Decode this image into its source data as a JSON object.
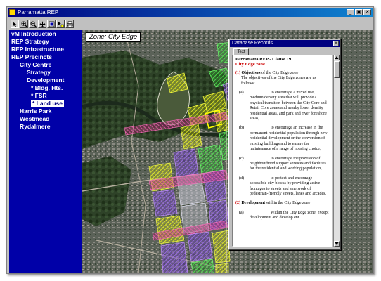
{
  "window": {
    "title": "Parramatta REP",
    "controls": {
      "minimize": "_",
      "maximize": "▣",
      "close": "✕"
    }
  },
  "toolbar": {
    "tools": [
      {
        "icon": "pointer-icon",
        "active": true
      },
      {
        "icon": "zoom-in-icon",
        "active": false
      },
      {
        "icon": "zoom-out-icon",
        "active": false
      },
      {
        "icon": "pan-icon",
        "active": false
      },
      {
        "icon": "full-extent-icon",
        "active": false
      },
      {
        "icon": "identify-icon",
        "active": false
      },
      {
        "icon": "print-icon",
        "active": false
      }
    ]
  },
  "sidebar": {
    "items": [
      {
        "label": "vM Introduction",
        "level": "top"
      },
      {
        "label": "REP Strategy",
        "level": "top"
      },
      {
        "label": "REP Infrastructure",
        "level": "top"
      },
      {
        "label": "REP Precincts",
        "level": "top"
      },
      {
        "label": "City Centre",
        "level": "lvl1"
      },
      {
        "label": "Strategy",
        "level": "lvl2"
      },
      {
        "label": "Development",
        "level": "lvl2"
      },
      {
        "label": "* Bldg. Hts.",
        "level": "lvl3"
      },
      {
        "label": "* FSR",
        "level": "lvl3"
      },
      {
        "label": "* Land use",
        "level": "lvl3",
        "selected": true
      },
      {
        "label": "Harris Park",
        "level": "sibling"
      },
      {
        "label": "Westmead",
        "level": "sibling"
      },
      {
        "label": "Rydalmere",
        "level": "sibling"
      }
    ]
  },
  "map": {
    "zone_label": "Zone: City Edge",
    "colors": {
      "yellow_zone": "#e8f020",
      "green_zone": "#40d840",
      "purple_zone": "#9060e0",
      "pink_road": "#f050a0",
      "selected_outline": "#ffff00"
    }
  },
  "dialog": {
    "title": "Database Records",
    "close": "x",
    "tab_label": "Text",
    "clause_title": "Parramatta REP - Clause 19",
    "zone_name": "City Edge zone",
    "objectives_num": "(1)",
    "objectives_head": "Objectives",
    "objectives_rest": " of the City Edge zone",
    "intro": "The objectives of the City Edge zones are as follows:",
    "items": [
      {
        "label": "(a)",
        "text": "to encourage a mixed use, medium density area that will provide a physical transition between the City Core and Retail Core zones and nearby lower density residential areas, and park and river foreshore areas,"
      },
      {
        "label": "(b)",
        "text": "to encourage an increase in the permanent residential population through new residential development or the conversion of existing buildings and to ensure the maintenance of a range of housing choice,"
      },
      {
        "label": "(c)",
        "text": "to encourage the provision of neighbourhood support services and facilities for the residential and working population,"
      },
      {
        "label": "(d)",
        "text": "to protect and encourage accessible city blocks by providing active frontages to streets and a network of pedestrian-friendly streets, lanes and arcades."
      }
    ],
    "development_num": "(2)",
    "development_head": "Development",
    "development_rest": " within the City Edge zone",
    "sub_item": {
      "label": "(a)",
      "text": "Within the City Edge zone, except development and develop ent"
    }
  }
}
